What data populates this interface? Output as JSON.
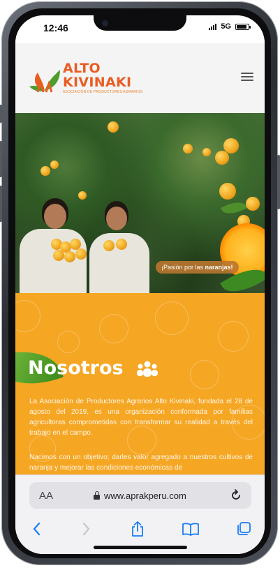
{
  "status_bar": {
    "time": "12:46",
    "network": "5G",
    "battery_level": 0.85
  },
  "site": {
    "logo": {
      "title_line1": "ALTO",
      "title_line2": "KIVINAKI",
      "tagline": "ASOCIACIÓN DE PRODUCTORES AGRARIOS",
      "colors": {
        "orange": "#e95d23",
        "green": "#4f9d2a"
      }
    },
    "menu_icon": "hamburger-icon"
  },
  "hero": {
    "slogan_prefix": "¡Pasión por las ",
    "slogan_bold": "naranjas!"
  },
  "about": {
    "title": "Nosotros",
    "icon": "team-icon",
    "paragraph_1": "La Asociación de Productores Agrarios Alto Kivinaki, fundada el 28 de agosto del 2019, es una organización conformada por familias agricultoras comprometidas con transformar su realidad a través del trabajo en el campo.",
    "paragraph_2": "Nacimos con un objetivo; darles valor agregado a nuestros cultivos de naranja y mejorar las condiciones económicas de",
    "background_color": "#f5a623"
  },
  "browser": {
    "text_size_label": "AA",
    "url": "www.aprakperu.com",
    "icons": [
      "back-icon",
      "forward-icon",
      "share-icon",
      "bookmarks-icon",
      "tabs-icon",
      "reload-icon",
      "lock-icon"
    ]
  }
}
